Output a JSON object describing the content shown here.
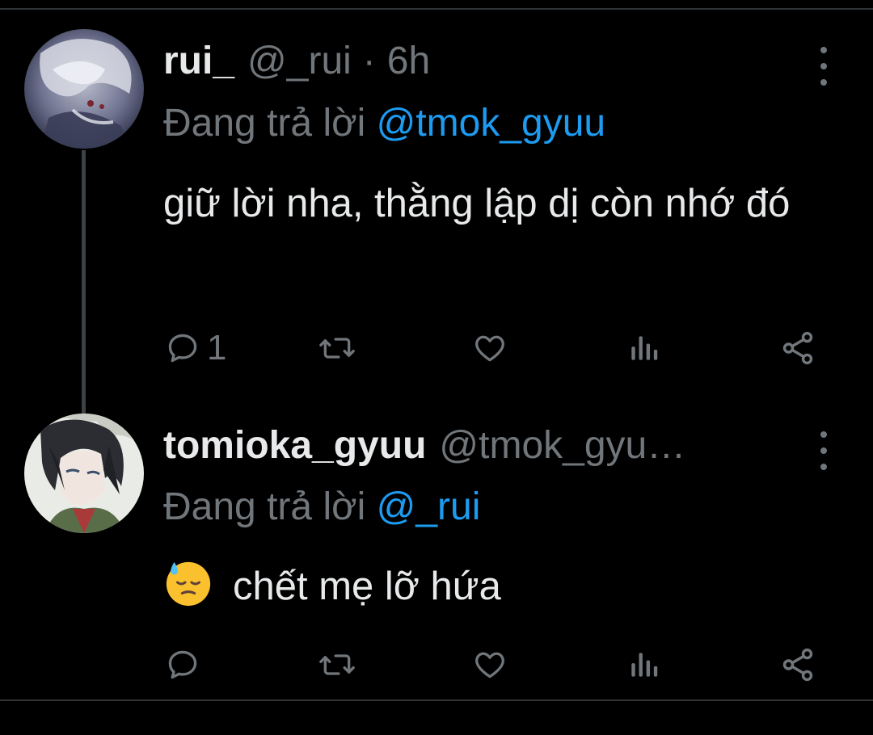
{
  "tweets": [
    {
      "display_name": "rui_",
      "handle": "@_rui",
      "separator": "·",
      "time": "6h",
      "reply_prefix": "Đang trả lời",
      "reply_mention": "@tmok_gyuu",
      "text": "giữ lời nha, thằng lập dị còn nhớ đó",
      "reply_count": "1",
      "avatar_icon": "avatar-rui"
    },
    {
      "display_name": "tomioka_gyuu",
      "handle": "@tmok_gyu…",
      "reply_prefix": "Đang trả lời",
      "reply_mention": "@_rui",
      "emoji": "downcast-face-with-sweat",
      "text": "chết mẹ lỡ hứa",
      "reply_count": "",
      "avatar_icon": "avatar-tomioka"
    }
  ],
  "colors": {
    "background": "#000000",
    "text_primary": "#e7e9ea",
    "text_secondary": "#71767b",
    "mention": "#1d9bf0",
    "divider": "#2f3336"
  }
}
